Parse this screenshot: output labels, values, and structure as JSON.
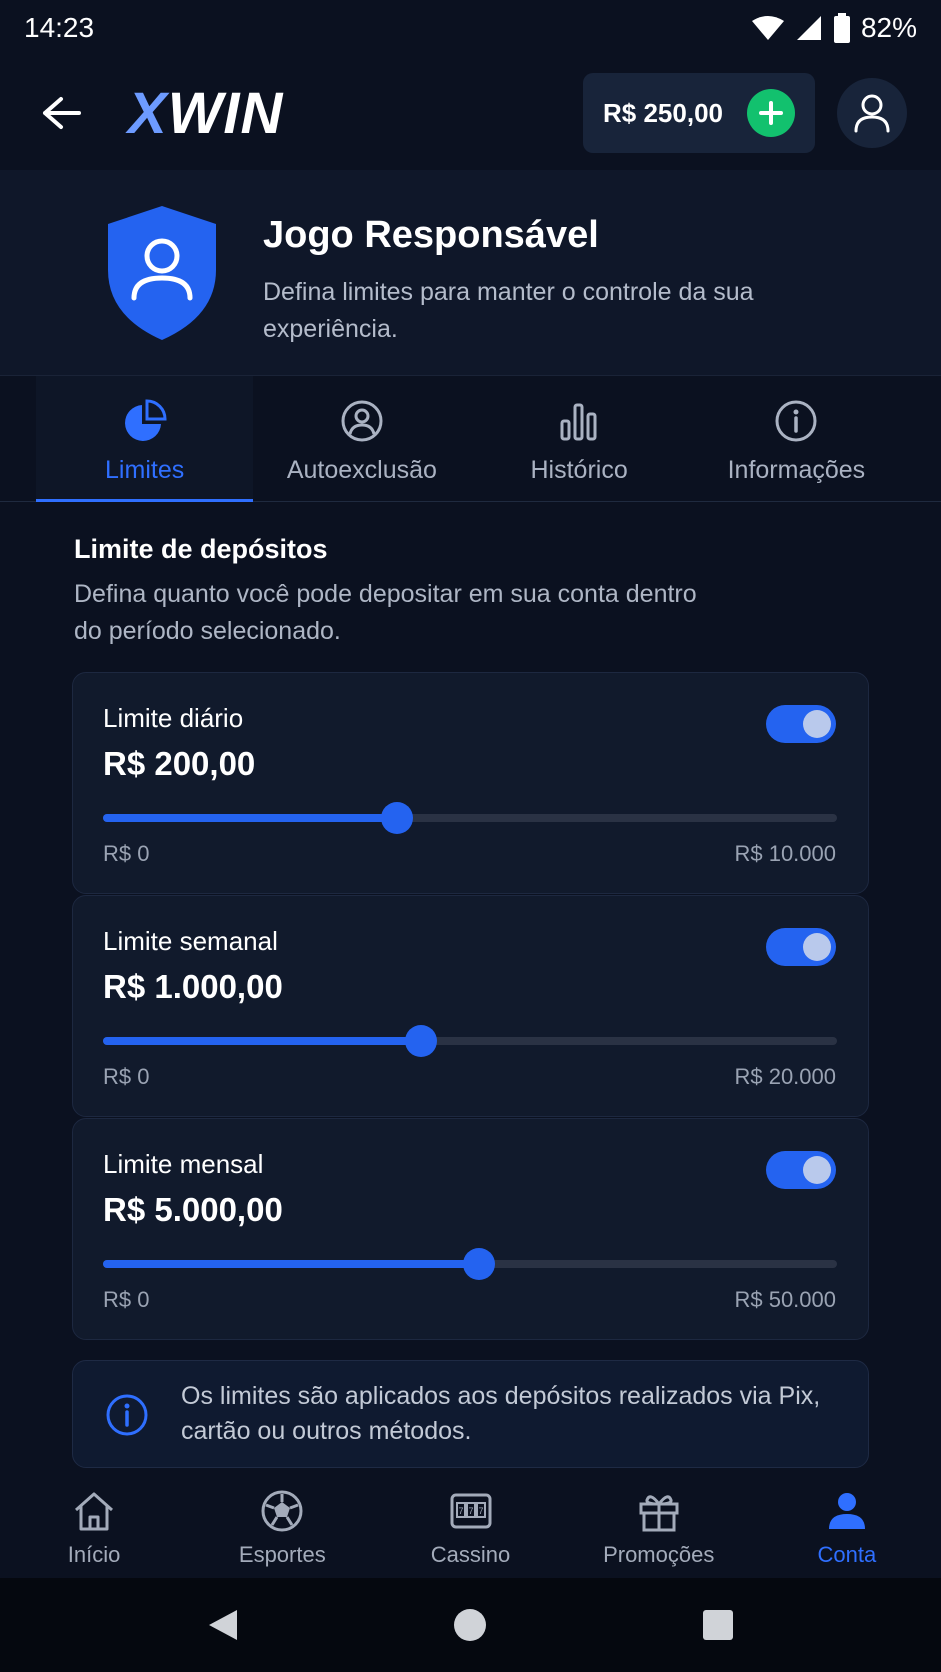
{
  "status": {
    "time": "14:23",
    "battery": "82%"
  },
  "header": {
    "logo_x": "X",
    "logo_rest": "WIN",
    "balance": "R$ 250,00"
  },
  "hero": {
    "title": "Jogo Responsável",
    "subtitle": "Defina limites para manter o controle da sua experiência."
  },
  "tabs": [
    {
      "label": "Limites",
      "icon": "pie-chart-icon",
      "active": true
    },
    {
      "label": "Autoexclusão",
      "icon": "user-circle-icon",
      "active": false
    },
    {
      "label": "Histórico",
      "icon": "bar-chart-icon",
      "active": false
    },
    {
      "label": "Informações",
      "icon": "info-icon",
      "active": false
    }
  ],
  "section": {
    "title": "Limite de depósitos",
    "description": "Defina quanto você pode depositar em sua conta dentro do período selecionado."
  },
  "limits": [
    {
      "label": "Limite diário",
      "value": "R$ 200,00",
      "min": "R$ 0",
      "max": "R$ 10.000",
      "enabled": true,
      "slider_fraction": 0.4
    },
    {
      "label": "Limite semanal",
      "value": "R$ 1.000,00",
      "min": "R$ 0",
      "max": "R$ 20.000",
      "enabled": true,
      "slider_fraction": 0.433
    },
    {
      "label": "Limite mensal",
      "value": "R$ 5.000,00",
      "min": "R$ 0",
      "max": "R$ 50.000",
      "enabled": true,
      "slider_fraction": 0.512
    }
  ],
  "info": {
    "text": "Os limites são aplicados aos depósitos realizados via Pix, cartão ou outros métodos."
  },
  "bottom_nav": [
    {
      "label": "Início",
      "icon": "home-icon",
      "active": false
    },
    {
      "label": "Esportes",
      "icon": "soccer-ball-icon",
      "active": false
    },
    {
      "label": "Cassino",
      "icon": "slot-machine-icon",
      "active": false
    },
    {
      "label": "Promoções",
      "icon": "gift-icon",
      "active": false
    },
    {
      "label": "Conta",
      "icon": "user-icon",
      "active": true
    }
  ],
  "colors": {
    "accent": "#2463f0",
    "success": "#12c16e",
    "background": "#0b1120"
  }
}
